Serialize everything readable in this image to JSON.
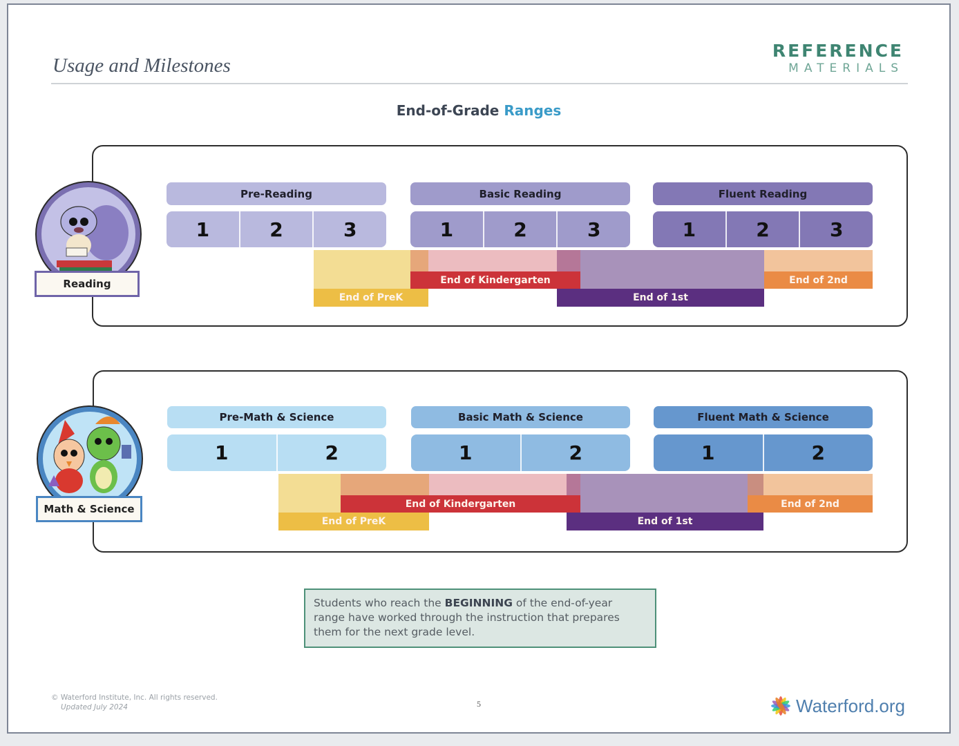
{
  "header": {
    "title": "Usage and Milestones",
    "brand_line1": "REFERENCE",
    "brand_line2": "MATERIALS"
  },
  "subtitle": {
    "part1": "End-of-Grade",
    "part2": "Ranges"
  },
  "colors": {
    "brand_green": "#3f8572",
    "accent_blue": "#3a9bc8",
    "prek_light": "#f3dd94",
    "prek_label": "#edbe45",
    "k_overlap": "#e6a77a",
    "k_light": "#ecbcc0",
    "k_label": "#cc3339",
    "k1_overlap": "#b57798",
    "first_light": "#a892ba",
    "first_label": "#5b2f80",
    "second_light": "#f2c49c",
    "second_label": "#ea8b45",
    "first2_overlap": "#c98e80"
  },
  "sections": [
    {
      "name": "reading",
      "badge_label": "Reading",
      "badge_icon": "squirrel-reading-icon",
      "badge_color": "#6f64a8",
      "levels": [
        {
          "label": "Pre-Reading",
          "units": [
            "1",
            "2",
            "3"
          ],
          "color": "#b9b9de"
        },
        {
          "label": "Basic Reading",
          "units": [
            "1",
            "2",
            "3"
          ],
          "color": "#9f9bcb"
        },
        {
          "label": "Fluent Reading",
          "units": [
            "1",
            "2",
            "3"
          ],
          "color": "#8378b5"
        }
      ],
      "ranges": [
        {
          "label": "End of PreK",
          "from": "Pre-Reading 3",
          "to": "Basic Reading 1 (start)"
        },
        {
          "label": "End of Kindergarten",
          "from": "Basic Reading 1",
          "to": "Basic Reading 3"
        },
        {
          "label": "End of 1st",
          "from": "Basic Reading 3",
          "to": "Fluent Reading 2"
        },
        {
          "label": "End of 2nd",
          "from": "Fluent Reading 2",
          "to": "Fluent Reading 3"
        }
      ]
    },
    {
      "name": "math-science",
      "badge_label": "Math & Science",
      "badge_icon": "bird-and-turtle-icon",
      "badge_color": "#4a86c2",
      "levels": [
        {
          "label": "Pre-Math & Science",
          "units": [
            "1",
            "2"
          ],
          "color": "#b8def3"
        },
        {
          "label": "Basic Math & Science",
          "units": [
            "1",
            "2"
          ],
          "color": "#8fbbe2"
        },
        {
          "label": "Fluent Math & Science",
          "units": [
            "1",
            "2"
          ],
          "color": "#6697ce"
        }
      ],
      "ranges": [
        {
          "label": "End of PreK",
          "from": "Pre-Math & Science 2",
          "to": "Basic Math & Science 1 (start)"
        },
        {
          "label": "End of Kindergarten",
          "from": "Pre-Math & Science 2",
          "to": "Basic Math & Science 2"
        },
        {
          "label": "End of 1st",
          "from": "Basic Math & Science 2",
          "to": "Fluent Math & Science 2 (start)"
        },
        {
          "label": "End of 2nd",
          "from": "Fluent Math & Science 1 (end)",
          "to": "Fluent Math & Science 2"
        }
      ]
    }
  ],
  "note": {
    "prefix": "Students who reach the ",
    "bold": "BEGINNING",
    "suffix": " of the end-of-year range have worked through the instruction that prepares them for the next grade level."
  },
  "footer": {
    "copyright": "© Waterford Institute, Inc. All rights reserved.",
    "updated": "Updated July 2024",
    "page_number": "5",
    "logo_text": "Waterford.org",
    "logo_icon": "waterford-star-icon"
  }
}
